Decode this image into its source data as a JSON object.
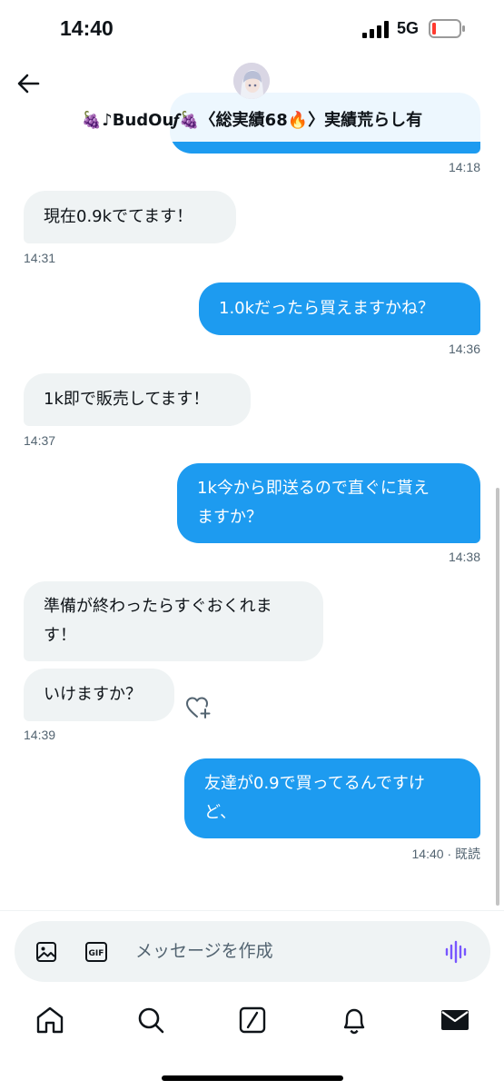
{
  "status_bar": {
    "time": "14:40",
    "network": "5G"
  },
  "header": {
    "title": "🍇♪BudOu𝆑🍇〈総実績68🔥〉実績荒らし有"
  },
  "messages": [
    {
      "direction": "out",
      "text": "",
      "time": "14:18"
    },
    {
      "direction": "in",
      "text": "現在0.9kでてます！",
      "time": "14:31"
    },
    {
      "direction": "out",
      "text": "1.0kだったら買えますかね？",
      "time": "14:36"
    },
    {
      "direction": "in",
      "text": "1k即で販売してます！",
      "time": "14:37"
    },
    {
      "direction": "out",
      "lines": [
        "1k今から即送るので直ぐに貰え",
        "ますか？"
      ],
      "time": "14:38"
    },
    {
      "direction": "in",
      "lines": [
        "準備が終わったらすぐおくれま",
        "す！"
      ]
    },
    {
      "direction": "in",
      "text": "いけますか？",
      "time": "14:39"
    },
    {
      "direction": "out",
      "lines": [
        "友達が0.9で買ってるんですけ",
        "ど、"
      ],
      "time": "14:40 · 既読"
    }
  ],
  "composer": {
    "placeholder": "メッセージを作成"
  },
  "icons": {
    "back": "arrow-left-icon",
    "react": "heart-plus-icon",
    "image": "image-icon",
    "gif": "gif-icon",
    "voice": "voice-wave-icon",
    "tabs": [
      "home-icon",
      "search-icon",
      "grok-icon",
      "bell-icon",
      "mail-icon"
    ]
  },
  "colors": {
    "accent": "#1d9bf0",
    "incoming_bubble": "#eff3f4",
    "voice": "#7856ff"
  }
}
